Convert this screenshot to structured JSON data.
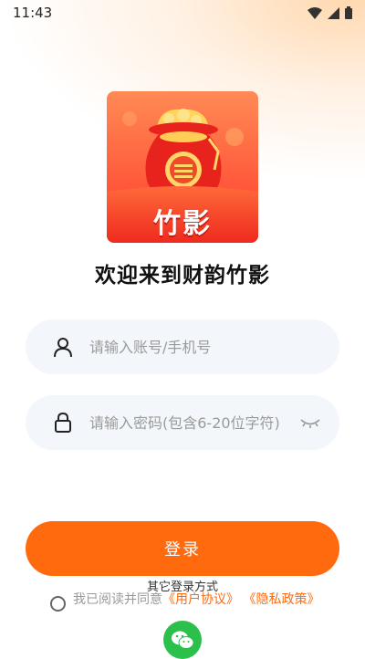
{
  "status_bar": {
    "time": "11:43"
  },
  "app": {
    "logo_text": "竹影",
    "welcome": "欢迎来到财韵竹影"
  },
  "form": {
    "account_placeholder": "请输入账号/手机号",
    "password_placeholder": "请输入密码(包含6-20位字符)"
  },
  "login_button": {
    "label": "登录"
  },
  "other_login": {
    "label": "其它登录方式"
  },
  "agreement": {
    "prefix": "我已阅读并同意",
    "user_agreement": "《用户协议》",
    "privacy_policy": "《隐私政策》"
  },
  "colors": {
    "accent": "#ff6a0e",
    "field_bg": "#f3f6fb",
    "wechat": "#2bbf4b"
  },
  "icons": [
    "wifi-icon",
    "signal-icon",
    "battery-icon",
    "user-icon",
    "lock-icon",
    "eye-closed-icon",
    "wechat-icon"
  ]
}
